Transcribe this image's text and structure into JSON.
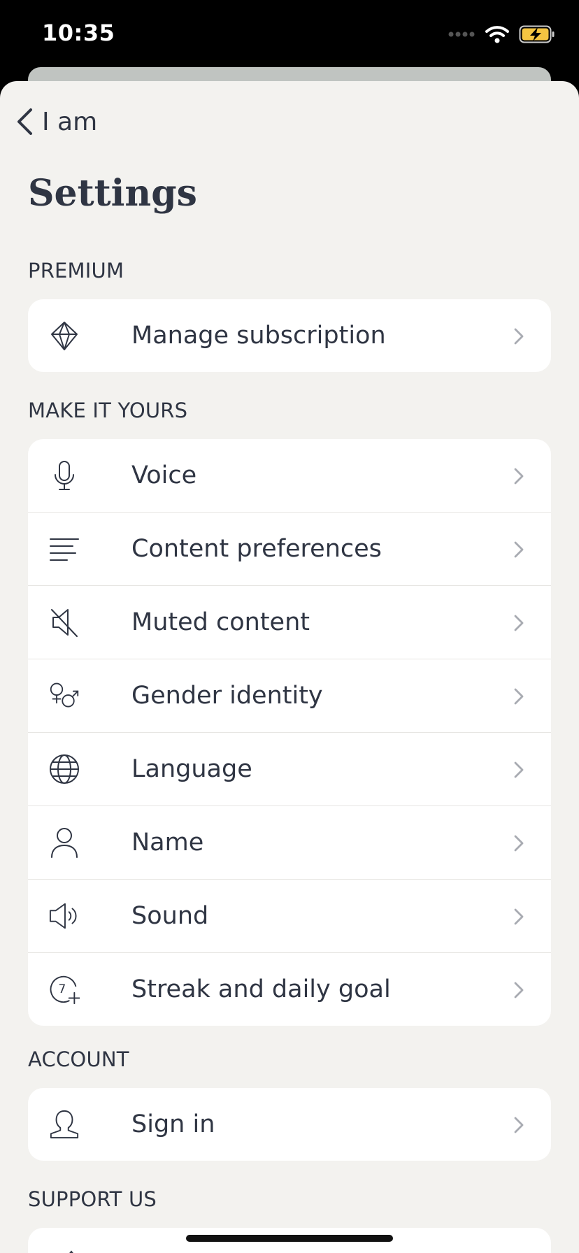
{
  "status_bar": {
    "time": "10:35",
    "icons": [
      "signal-icon",
      "wifi-icon",
      "battery-charging-icon"
    ],
    "battery_color": "#f4c542"
  },
  "nav": {
    "back_label": "I am",
    "back_icon": "chevron-left-icon"
  },
  "page": {
    "title": "Settings"
  },
  "colors": {
    "sheet_background": "#f3f2ef",
    "card_background": "#ffffff",
    "text": "#2f3543",
    "chevron": "#a8abb2"
  },
  "sections": {
    "premium": {
      "header": "PREMIUM",
      "items": [
        {
          "label": "Manage subscription",
          "icon": "diamond-icon"
        }
      ]
    },
    "make_it_yours": {
      "header": "MAKE IT YOURS",
      "items": [
        {
          "label": "Voice",
          "icon": "microphone-icon"
        },
        {
          "label": "Content preferences",
          "icon": "lines-icon"
        },
        {
          "label": "Muted content",
          "icon": "muted-speaker-icon"
        },
        {
          "label": "Gender identity",
          "icon": "gender-icon"
        },
        {
          "label": "Language",
          "icon": "globe-icon"
        },
        {
          "label": "Name",
          "icon": "person-icon"
        },
        {
          "label": "Sound",
          "icon": "speaker-icon"
        },
        {
          "label": "Streak and daily goal",
          "icon": "streak-icon",
          "icon_text": "7"
        }
      ]
    },
    "account": {
      "header": "ACCOUNT",
      "items": [
        {
          "label": "Sign in",
          "icon": "user-icon"
        }
      ]
    },
    "support_us": {
      "header": "SUPPORT US"
    }
  }
}
